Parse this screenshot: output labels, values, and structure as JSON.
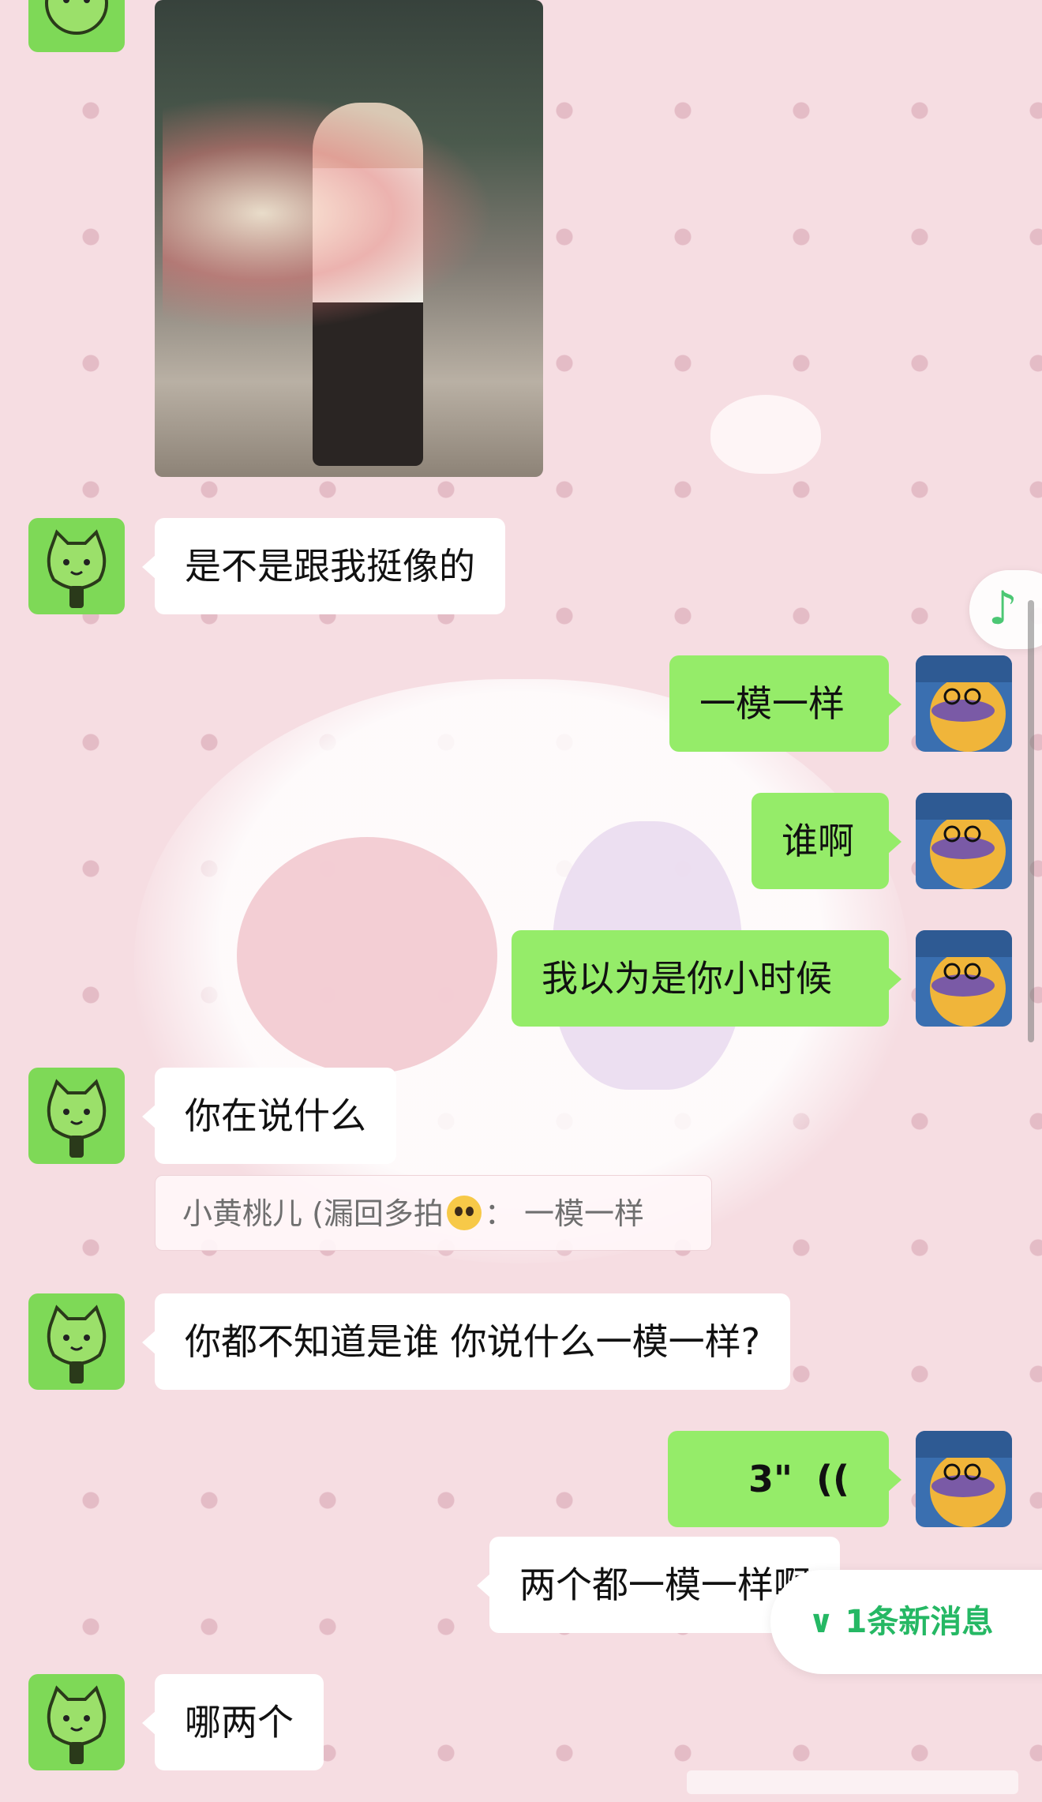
{
  "messages": [
    {
      "id": "m1",
      "side": "in",
      "type": "image"
    },
    {
      "id": "m2",
      "side": "in",
      "type": "text",
      "text": "是不是跟我挺像的"
    },
    {
      "id": "m3",
      "side": "out",
      "type": "text",
      "text": "一模一样"
    },
    {
      "id": "m4",
      "side": "out",
      "type": "text",
      "text": "谁啊"
    },
    {
      "id": "m5",
      "side": "out",
      "type": "text",
      "text": "我以为是你小时候"
    },
    {
      "id": "m6",
      "side": "in",
      "type": "text",
      "text": "你在说什么",
      "quote": {
        "prefix": "小黄桃儿 (漏回多拍",
        "suffix": "：  一模一样"
      }
    },
    {
      "id": "m7",
      "side": "in",
      "type": "text",
      "text": "你都不知道是谁 你说什么一模一样?"
    },
    {
      "id": "m8",
      "side": "out",
      "type": "voice",
      "duration": "3\"",
      "icon": "(("
    },
    {
      "id": "m9",
      "side": "out",
      "type": "text",
      "text": "两个都一模一样啊"
    },
    {
      "id": "m10",
      "side": "in",
      "type": "text",
      "text": "哪两个"
    }
  ],
  "new_message_pill": {
    "label": "1条新消息",
    "icon": "double-chevron-down-icon"
  },
  "floating_button": {
    "icon": "music-note-icon",
    "glyph": "♪"
  },
  "colors": {
    "incoming_bubble": "#ffffff",
    "outgoing_bubble": "#95ec69",
    "accent_green": "#25b864",
    "background": "#f6dde2"
  }
}
